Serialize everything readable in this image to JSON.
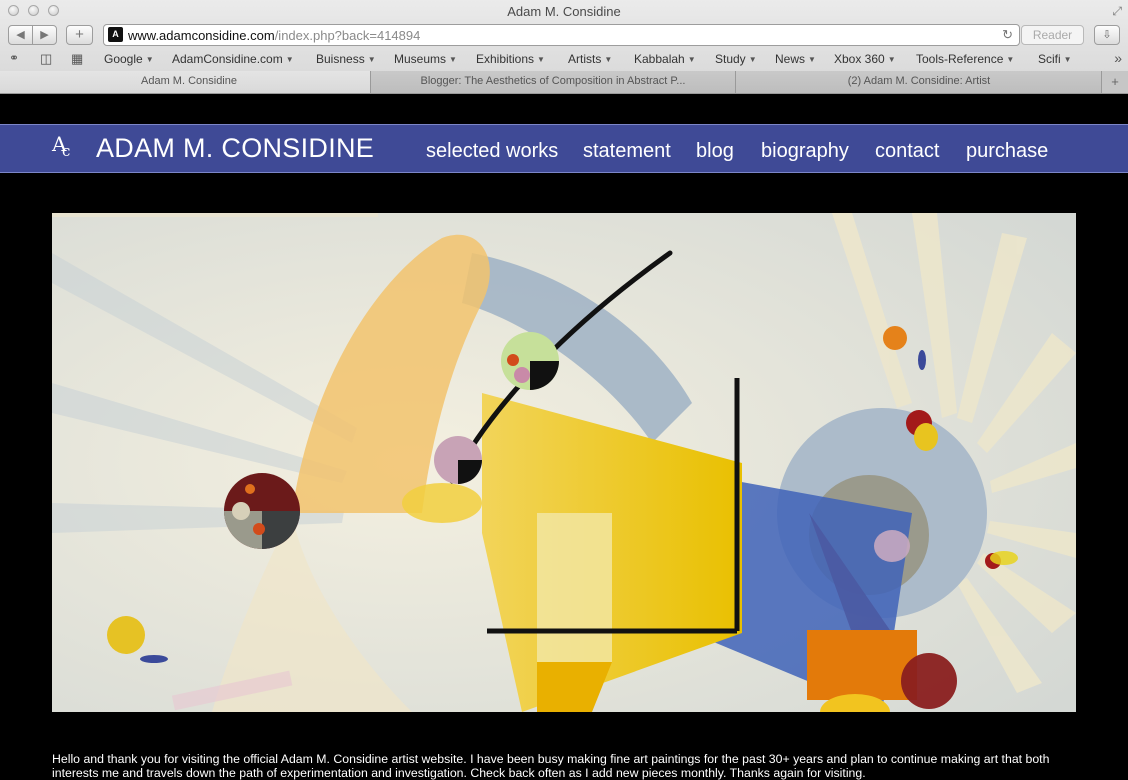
{
  "window": {
    "title": "Adam M. Considine"
  },
  "toolbar": {
    "back_label": "◀",
    "forward_label": "▶",
    "add_label": "+",
    "url_host": "www.adamconsidine.com",
    "url_path": "/index.php?back=414894",
    "favicon_text": "A",
    "reader_label": "Reader"
  },
  "bookmarks": [
    {
      "label": "Google"
    },
    {
      "label": "AdamConsidine.com"
    },
    {
      "label": "Buisness"
    },
    {
      "label": "Museums"
    },
    {
      "label": "Exhibitions"
    },
    {
      "label": "Artists"
    },
    {
      "label": "Kabbalah"
    },
    {
      "label": "Study"
    },
    {
      "label": "News"
    },
    {
      "label": "Xbox 360"
    },
    {
      "label": "Tools-Reference"
    },
    {
      "label": "Scifi"
    }
  ],
  "tabs": [
    {
      "label": "Adam M. Considine",
      "active": true
    },
    {
      "label": "Blogger: The Aesthetics of Composition in Abstract P...",
      "active": false
    },
    {
      "label": "(2) Adam M. Considine: Artist",
      "active": false
    }
  ],
  "site": {
    "logo_a": "A",
    "logo_c": "c",
    "title": "ADAM M. CONSIDINE",
    "menu": [
      {
        "label": "selected works"
      },
      {
        "label": "statement"
      },
      {
        "label": "blog"
      },
      {
        "label": "biography"
      },
      {
        "label": "contact"
      },
      {
        "label": "purchase"
      }
    ],
    "intro": "Hello and thank you for visiting the official Adam M. Considine artist website. I have been busy making fine art paintings for the past 30+ years and plan to continue making art that both interests me and travels down the path of experimentation and investigation. Check back often as I add new pieces monthly. Thanks again for visiting."
  },
  "icons": {
    "reload": "↻",
    "download": "⇩",
    "reading_list": "👓",
    "bookmarks_book": "▯",
    "top_sites": "▦",
    "more": "»",
    "fullscreen": "⤢",
    "tab_add": "+"
  }
}
